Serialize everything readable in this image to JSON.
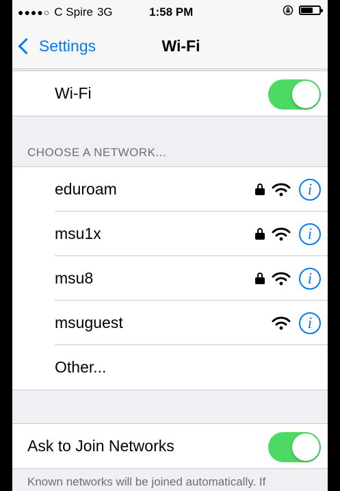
{
  "status_bar": {
    "signal_dots": "●●●●○",
    "carrier": "C Spire",
    "network": "3G",
    "time": "1:58 PM",
    "battery_level": 0.62
  },
  "nav": {
    "back_label": "Settings",
    "title": "Wi-Fi"
  },
  "wifi_row": {
    "label": "Wi-Fi",
    "enabled": true
  },
  "networks_section": {
    "header": "CHOOSE A NETWORK...",
    "items": [
      {
        "name": "eduroam",
        "secured": true
      },
      {
        "name": "msu1x",
        "secured": true
      },
      {
        "name": "msu8",
        "secured": true
      },
      {
        "name": "msuguest",
        "secured": false
      }
    ],
    "other_label": "Other..."
  },
  "ask_join": {
    "label": "Ask to Join Networks",
    "enabled": true
  },
  "footer_text": "Known networks will be joined automatically. If",
  "colors": {
    "accent": "#0079ff",
    "toggle_on": "#4cd964",
    "background": "#efeff4"
  },
  "icons": {
    "info": "i",
    "lock": "lock-icon",
    "wifi": "wifi-icon"
  }
}
